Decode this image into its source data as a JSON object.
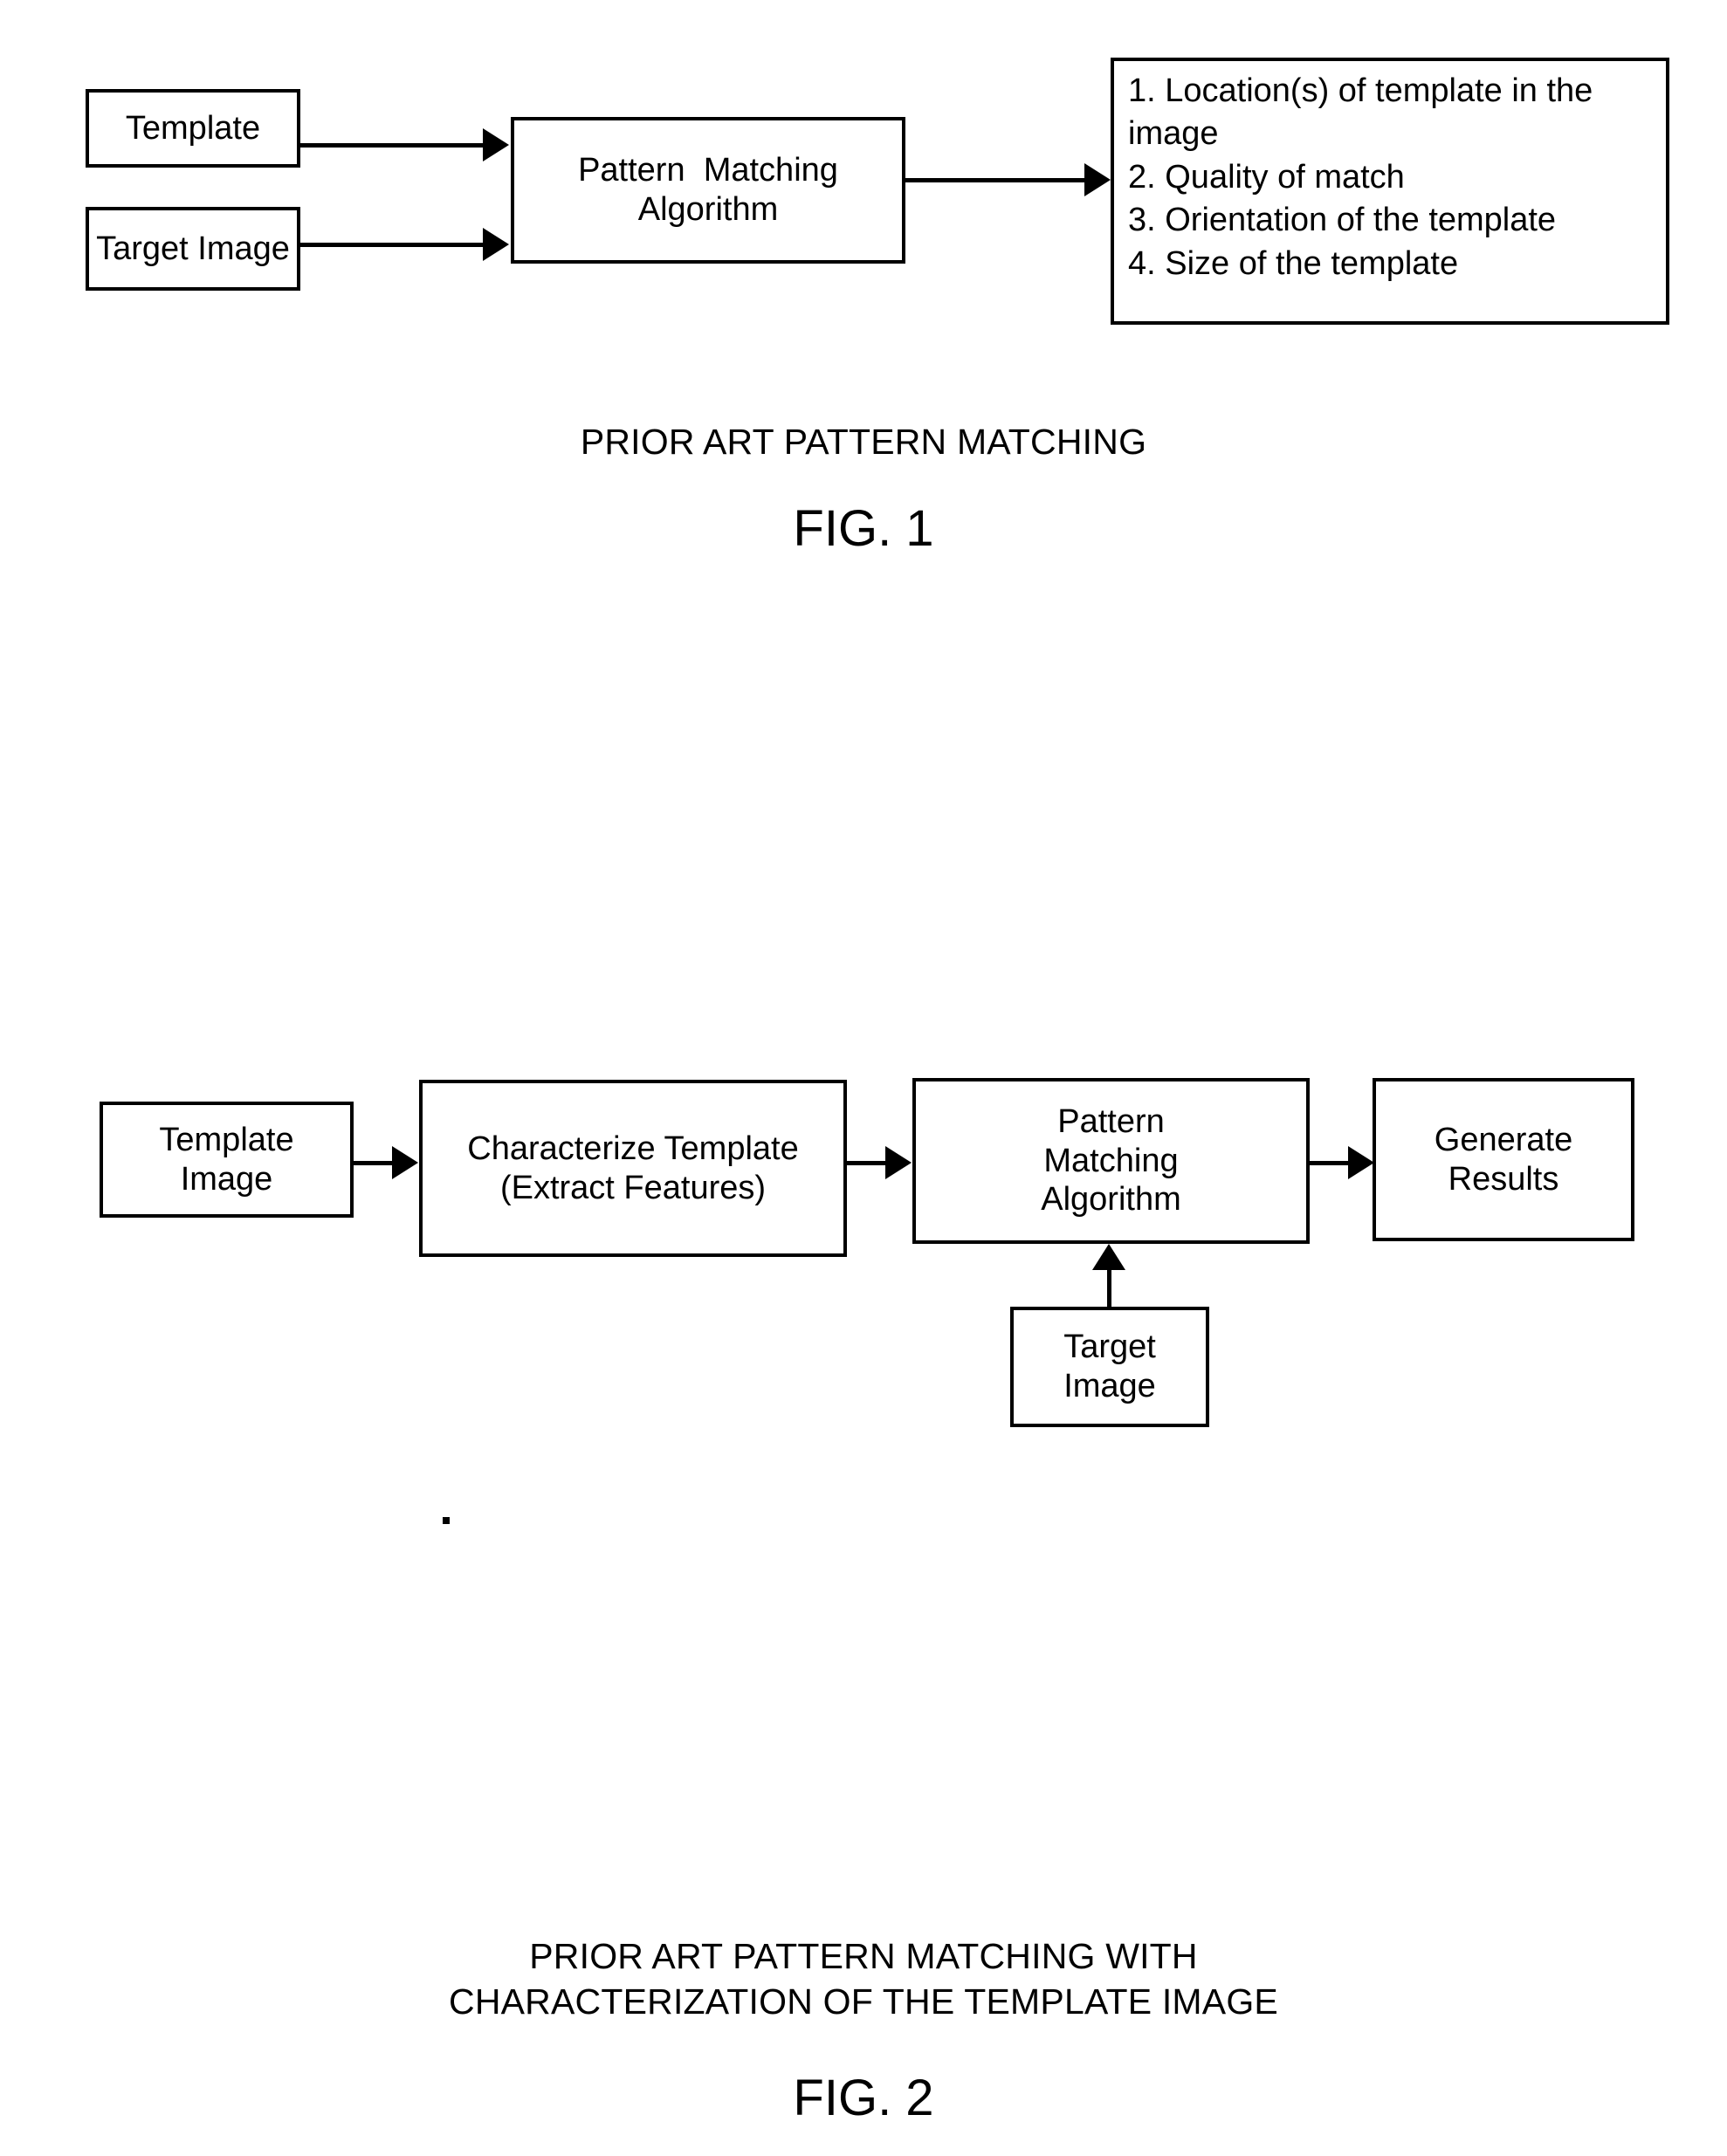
{
  "figure1": {
    "boxes": {
      "template": {
        "line1": "Template"
      },
      "target_image": {
        "line1": "Target Image"
      },
      "pattern_matching": {
        "line1": "Pattern  Matching",
        "line2": "Algorithm"
      },
      "results": {
        "item1": "1. Location(s) of template in the",
        "item1_cont": "image",
        "item2": "2. Quality of match",
        "item3": "3. Orientation of the template",
        "item4": "4. Size of the template"
      }
    },
    "caption": "PRIOR ART PATTERN MATCHING",
    "fig_label": "FIG. 1"
  },
  "figure2": {
    "boxes": {
      "template_image": {
        "line1": "Template",
        "line2": "Image"
      },
      "characterize": {
        "line1": "Characterize Template",
        "line2": "(Extract Features)"
      },
      "pattern_matching": {
        "line1": "Pattern",
        "line2": "Matching",
        "line3": "Algorithm"
      },
      "generate_results": {
        "line1": "Generate",
        "line2": "Results"
      },
      "target_image": {
        "line1": "Target",
        "line2": "Image"
      }
    },
    "caption_line1": "PRIOR ART PATTERN MATCHING WITH",
    "caption_line2": "CHARACTERIZATION OF THE TEMPLATE IMAGE",
    "fig_label": "FIG. 2"
  },
  "colors": {
    "ink": "#000000",
    "paper": "#ffffff"
  }
}
